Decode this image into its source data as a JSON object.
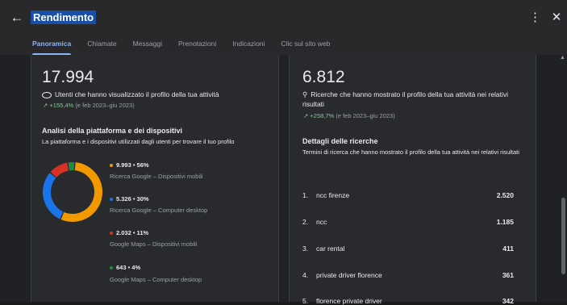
{
  "header": {
    "title": "Rendimento",
    "back_icon": "arrow-left-icon",
    "menu_icon": "more-vert-icon",
    "close_icon": "close-icon"
  },
  "tabs": [
    {
      "label": "Panoramica",
      "active": true
    },
    {
      "label": "Chiamate"
    },
    {
      "label": "Messaggi"
    },
    {
      "label": "Prenotazioni"
    },
    {
      "label": "Indicazioni"
    },
    {
      "label": "Clic sul sito web"
    }
  ],
  "profile_views": {
    "total": "17.994",
    "icon": "eye-icon",
    "label": "Utenti che hanno visualizzato il profilo della tua attività",
    "trend_icon": "trending-up-icon",
    "trend_value": "+155,4%",
    "trend_period": "(e feb 2023–giu 2023)"
  },
  "platform": {
    "title": "Analisi della piattaforma e dei dispositivi",
    "subtitle": "La piattaforma e i dispositivi utilizzati dagli utenti per trovare il tuo profilo",
    "items": [
      {
        "value": "9.993 • 56%",
        "label": "Ricerca Google – Dispositivi mobili",
        "color": "#f29900",
        "fraction": 0.56
      },
      {
        "value": "5.326 • 30%",
        "label": "Ricerca Google – Computer desktop",
        "color": "#1a73e8",
        "fraction": 0.3
      },
      {
        "value": "2.032 • 11%",
        "label": "Google Maps – Dispositivi mobili",
        "color": "#d93025",
        "fraction": 0.11
      },
      {
        "value": "643 • 4%",
        "label": "Google Maps – Computer desktop",
        "color": "#1e8e3e",
        "fraction": 0.04
      }
    ]
  },
  "searches": {
    "total": "6.812",
    "icon": "search-icon",
    "label": "Ricerche che hanno mostrato il profilo della tua attività nei relativi risultati",
    "trend_icon": "trending-up-icon",
    "trend_value": "+258,7%",
    "trend_period": "(e feb 2023–giu 2023)"
  },
  "search_details": {
    "title": "Dettagli delle ricerche",
    "subtitle": "Termini di ricerca che hanno mostrato il profilo della tua attività nei relativi risultati",
    "rows": [
      {
        "num": "1.",
        "term": "ncc firenze",
        "count": "2.520"
      },
      {
        "num": "2.",
        "term": "ncc",
        "count": "1.185"
      },
      {
        "num": "3.",
        "term": "car rental",
        "count": "411"
      },
      {
        "num": "4.",
        "term": "private driver florence",
        "count": "361"
      },
      {
        "num": "5.",
        "term": "florence private driver",
        "count": "342"
      }
    ]
  }
}
